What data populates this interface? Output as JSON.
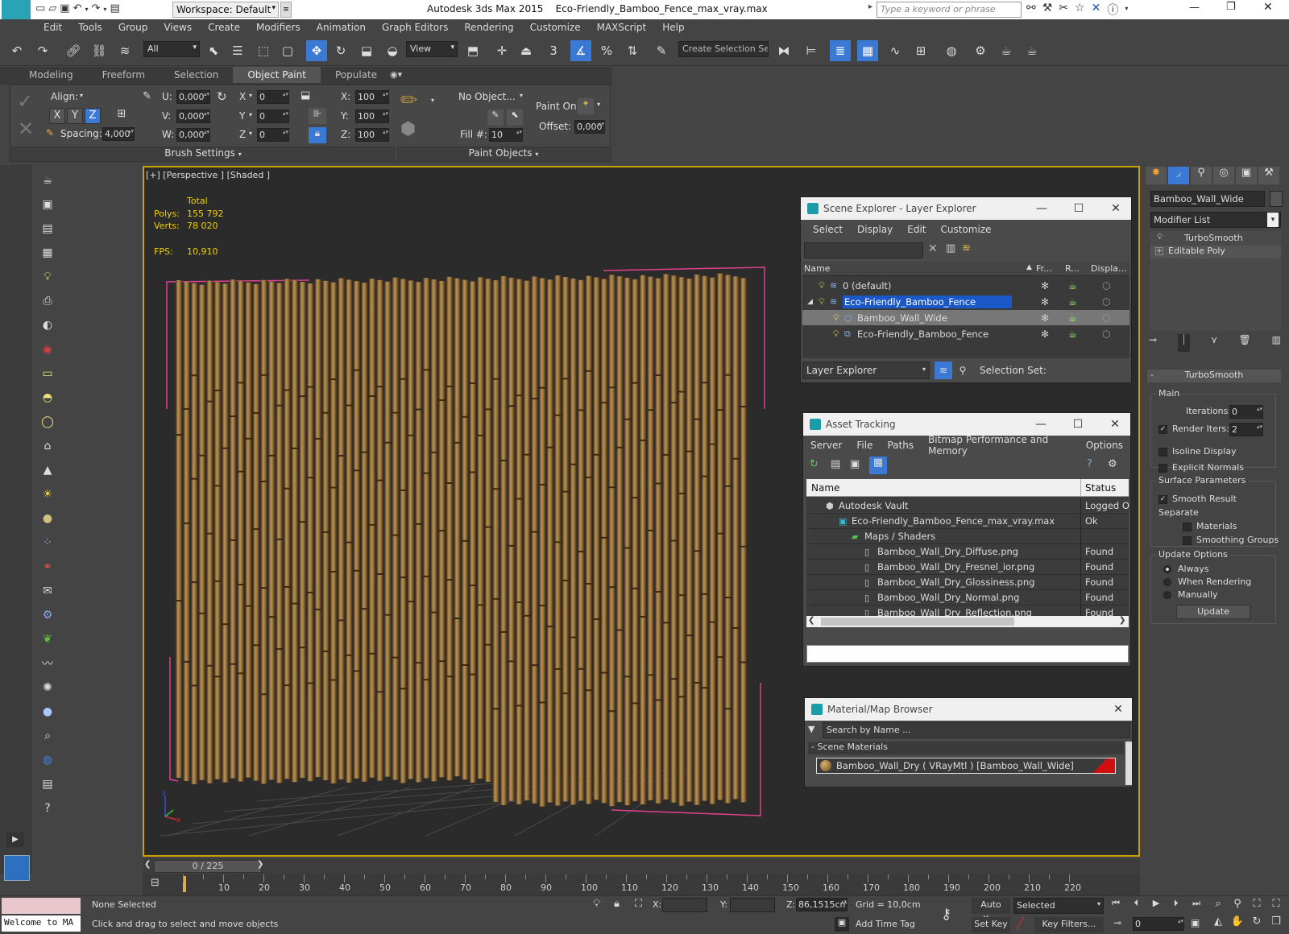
{
  "app": {
    "title": "Autodesk 3ds Max  2015",
    "filename": "Eco-Friendly_Bamboo_Fence_max_vray.max",
    "workspace": "Workspace: Default",
    "search_placeholder": "Type a keyword or phrase",
    "logo": "MAX"
  },
  "menu": [
    "Edit",
    "Tools",
    "Group",
    "Views",
    "Create",
    "Modifiers",
    "Animation",
    "Graph Editors",
    "Rendering",
    "Customize",
    "MAXScript",
    "Help"
  ],
  "toolbar": {
    "filter": "All",
    "view": "View",
    "selection_set": "Create Selection Se",
    "snap_label": "3",
    "percent_label": "%"
  },
  "ribbon": {
    "tabs": [
      "Modeling",
      "Freeform",
      "Selection",
      "Object Paint",
      "Populate"
    ],
    "active_tab": "Object Paint",
    "align_label": "Align:",
    "x": "X",
    "y": "Y",
    "z": "Z",
    "spacing_label": "Spacing:",
    "spacing_value": "4,000",
    "u_label": "U:",
    "v_label": "V:",
    "w_label": "W:",
    "u_value": "0,000",
    "v_value": "0,000",
    "w_value": "0,000",
    "rx_label": "X",
    "ry_label": "Y",
    "rz_label": "Z",
    "rx_value": "0",
    "ry_value": "0",
    "rz_value": "0",
    "sx_label": "X:",
    "sy_label": "Y:",
    "sz_label": "Z:",
    "sx_value": "100",
    "sy_value": "100",
    "sz_value": "100",
    "no_object": "No Object...",
    "fill_label": "Fill #:",
    "fill_value": "10",
    "paint_on_label": "Paint On:",
    "offset_label": "Offset:",
    "offset_value": "0,000",
    "brush_settings": "Brush Settings",
    "paint_objects": "Paint Objects"
  },
  "viewport": {
    "label": "[+] [Perspective ] [Shaded ]",
    "stats_total": "Total",
    "polys_label": "Polys:",
    "polys_value": "155 792",
    "verts_label": "Verts:",
    "verts_value": "78 020",
    "fps_label": "FPS:",
    "fps_value": "10,910"
  },
  "scene_explorer": {
    "title": "Scene Explorer - Layer Explorer",
    "menu": [
      "Select",
      "Display",
      "Edit",
      "Customize"
    ],
    "columns": [
      "Name",
      "Fr...",
      "R...",
      "Displa..."
    ],
    "rows": [
      {
        "name": "0 (default)",
        "indent": 0
      },
      {
        "name": "Eco-Friendly_Bamboo_Fence",
        "indent": 0
      },
      {
        "name": "Bamboo_Wall_Wide",
        "indent": 1
      },
      {
        "name": "Eco-Friendly_Bamboo_Fence",
        "indent": 1
      }
    ],
    "footer_dropdown": "Layer Explorer",
    "selection_set_label": "Selection Set:"
  },
  "asset_tracking": {
    "title": "Asset Tracking",
    "menu": [
      "Server",
      "File",
      "Paths",
      "Bitmap Performance and Memory",
      "Options"
    ],
    "columns": [
      "Name",
      "Status"
    ],
    "rows": [
      {
        "name": "Autodesk Vault",
        "status": "Logged O",
        "indent": 1
      },
      {
        "name": "Eco-Friendly_Bamboo_Fence_max_vray.max",
        "status": "Ok",
        "indent": 2
      },
      {
        "name": "Maps / Shaders",
        "status": "",
        "indent": 3
      },
      {
        "name": "Bamboo_Wall_Dry_Diffuse.png",
        "status": "Found",
        "indent": 4
      },
      {
        "name": "Bamboo_Wall_Dry_Fresnel_ior.png",
        "status": "Found",
        "indent": 4
      },
      {
        "name": "Bamboo_Wall_Dry_Glossiness.png",
        "status": "Found",
        "indent": 4
      },
      {
        "name": "Bamboo_Wall_Dry_Normal.png",
        "status": "Found",
        "indent": 4
      },
      {
        "name": "Bamboo_Wall_Dry_Reflection.png",
        "status": "Found",
        "indent": 4
      }
    ]
  },
  "material_browser": {
    "title": "Material/Map Browser",
    "search_placeholder": "Search by Name ...",
    "section": "Scene Materials",
    "material": "Bamboo_Wall_Dry ( VRayMtl ) [Bamboo_Wall_Wide]"
  },
  "command_panel": {
    "object_name": "Bamboo_Wall_Wide",
    "modifier_list": "Modifier List",
    "stack": [
      "TurboSmooth",
      "Editable Poly"
    ],
    "rollout_title": "TurboSmooth",
    "main_group": "Main",
    "iterations_label": "Iterations:",
    "iterations_value": "0",
    "render_iters_label": "Render Iters:",
    "render_iters_value": "2",
    "isoline": "Isoline Display",
    "explicit_normals": "Explicit Normals",
    "surface_group": "Surface Parameters",
    "smooth_result": "Smooth Result",
    "separate_label": "Separate",
    "materials": "Materials",
    "smoothing_groups": "Smoothing Groups",
    "update_group": "Update Options",
    "always": "Always",
    "when_rendering": "When Rendering",
    "manually": "Manually",
    "update_button": "Update"
  },
  "timeline": {
    "frame": "0 / 225",
    "ticks": [
      "10",
      "20",
      "30",
      "40",
      "50",
      "60",
      "70",
      "80",
      "90",
      "100",
      "110",
      "120",
      "130",
      "140",
      "150",
      "160",
      "170",
      "180",
      "190",
      "200",
      "210",
      "220"
    ]
  },
  "status": {
    "maxscript": "Welcome to MA",
    "selection": "None Selected",
    "prompt": "Click and drag to select and move objects",
    "x_label": "X:",
    "y_label": "Y:",
    "z_label": "Z:",
    "z_value": "86,1515cm",
    "grid": "Grid = 10,0cm",
    "add_time_tag": "Add Time Tag",
    "auto_key": "Auto Key",
    "set_key": "Set Key",
    "key_mode": "Selected",
    "key_filters": "Key Filters...",
    "frame_value": "0"
  }
}
